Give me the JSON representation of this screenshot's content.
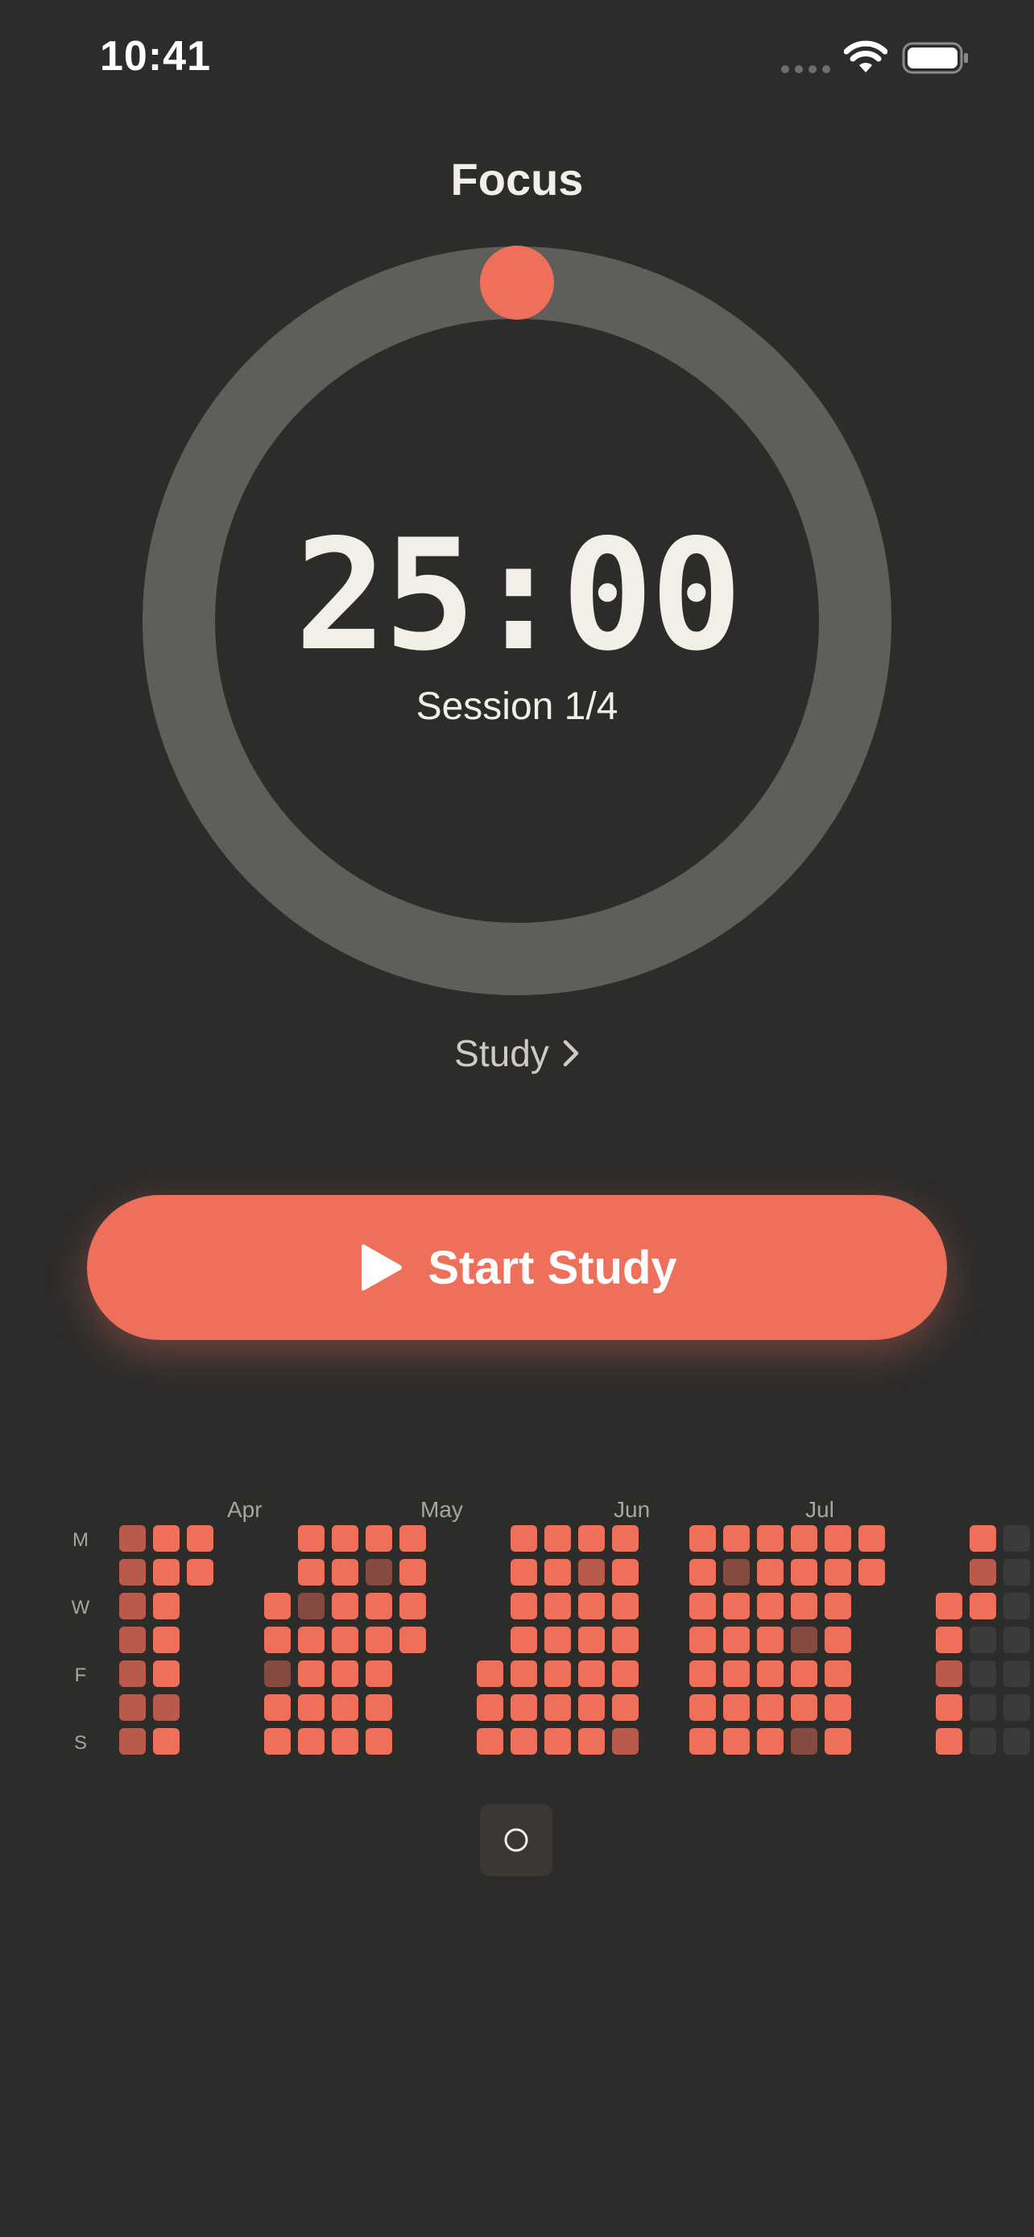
{
  "status_bar": {
    "time": "10:41",
    "icons": [
      "cellular-icon",
      "wifi-icon",
      "battery-icon"
    ]
  },
  "title": "Focus",
  "timer": {
    "value": "25:00",
    "session": "Session 1/4",
    "progress": 0
  },
  "mode": {
    "label": "Study",
    "icon": "chevron-right-icon"
  },
  "start_button": {
    "label": "Start Study",
    "icon": "play-icon"
  },
  "heatmap": {
    "months": [
      "Apr",
      "May",
      "Jun",
      "Jul"
    ],
    "day_labels": [
      "M",
      "W",
      "F",
      "S"
    ]
  },
  "home_button": {
    "icon": "circle-icon"
  },
  "colors": {
    "background": "#2c2c2b",
    "accent": "#ee6f5a",
    "accent_dim": "#b95b4c",
    "accent_dark": "#864b40",
    "empty_cell": "#3b3b3a",
    "ring_track": "#5f5e5b",
    "text": "#f2efe9"
  }
}
